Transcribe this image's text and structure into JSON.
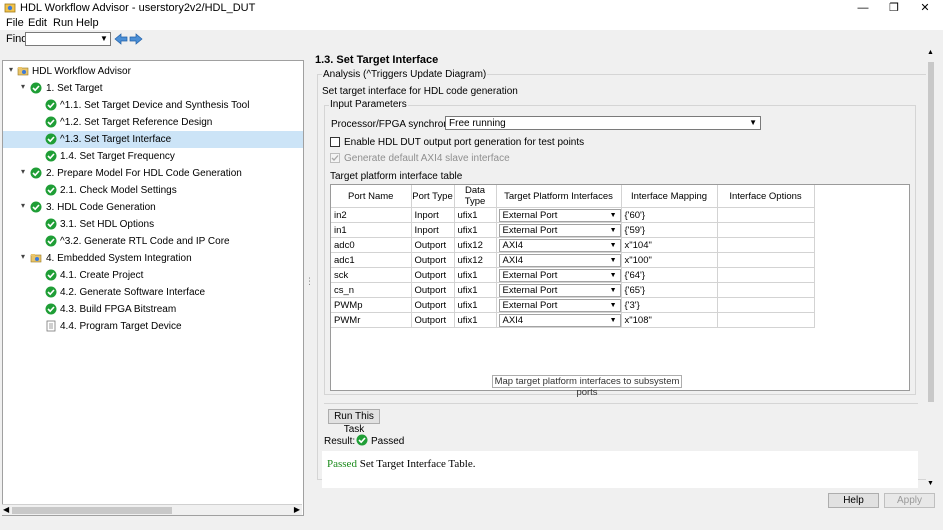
{
  "window": {
    "title": "HDL Workflow Advisor - userstory2v2/HDL_DUT",
    "minimize": "—",
    "maximize": "❐",
    "close": "✕"
  },
  "menu": [
    "File",
    "Edit",
    "Run",
    "Help"
  ],
  "find": {
    "label": "Find:",
    "value": ""
  },
  "tree": [
    {
      "label": "HDL Workflow Advisor",
      "icon": "folder-icon",
      "expander": "▾"
    },
    {
      "label": "1. Set Target",
      "icon": "check-icon",
      "expander": "▾"
    },
    {
      "label": "^1.1. Set Target Device and Synthesis Tool",
      "icon": "check-icon"
    },
    {
      "label": "^1.2. Set Target Reference Design",
      "icon": "check-icon"
    },
    {
      "label": "^1.3. Set Target Interface",
      "icon": "check-icon",
      "selected": true
    },
    {
      "label": "1.4. Set Target Frequency",
      "icon": "check-icon"
    },
    {
      "label": "2. Prepare Model For HDL Code Generation",
      "icon": "check-icon",
      "expander": "▾"
    },
    {
      "label": "2.1. Check Model Settings",
      "icon": "check-icon"
    },
    {
      "label": "3. HDL Code Generation",
      "icon": "check-icon",
      "expander": "▾"
    },
    {
      "label": "3.1. Set HDL Options",
      "icon": "check-icon"
    },
    {
      "label": "^3.2. Generate RTL Code and IP Core",
      "icon": "check-icon"
    },
    {
      "label": "4. Embedded System Integration",
      "icon": "folder-icon",
      "expander": "▾"
    },
    {
      "label": "4.1. Create Project",
      "icon": "check-icon"
    },
    {
      "label": "4.2. Generate Software Interface",
      "icon": "check-icon"
    },
    {
      "label": "4.3. Build FPGA Bitstream",
      "icon": "check-icon"
    },
    {
      "label": "4.4. Program Target Device",
      "icon": "task-icon"
    }
  ],
  "panel": {
    "title": "1.3. Set Target Interface",
    "analysis": "Analysis (^Triggers Update Diagram)",
    "description": "Set target interface for HDL code generation",
    "input_params_label": "Input Parameters",
    "sync_label": "Processor/FPGA synchronization:",
    "sync_value": "Free running",
    "enable_test_points": "Enable HDL DUT output port generation for test points",
    "generate_axi4": "Generate default AXI4 slave interface",
    "table_label": "Target platform interface table",
    "map_button": "Map target platform interfaces to subsystem ports",
    "run_button": "Run This Task",
    "result_label": "Result:",
    "result_value": "Passed",
    "result_msg_status": "Passed",
    "result_msg_text": " Set Target Interface Table."
  },
  "table": {
    "headers": [
      "Port Name",
      "Port Type",
      "Data Type",
      "Target Platform Interfaces",
      "Interface Mapping",
      "Interface Options"
    ],
    "rows": [
      [
        "in2",
        "Inport",
        "ufix1",
        "External Port",
        "{'60'}",
        ""
      ],
      [
        "in1",
        "Inport",
        "ufix1",
        "External Port",
        "{'59'}",
        ""
      ],
      [
        "adc0",
        "Outport",
        "ufix12",
        "AXI4",
        "x\"104\"",
        ""
      ],
      [
        "adc1",
        "Outport",
        "ufix12",
        "AXI4",
        "x\"100\"",
        ""
      ],
      [
        "sck",
        "Outport",
        "ufix1",
        "External Port",
        "{'64'}",
        ""
      ],
      [
        "cs_n",
        "Outport",
        "ufix1",
        "External Port",
        "{'65'}",
        ""
      ],
      [
        "PWMp",
        "Outport",
        "ufix1",
        "External Port",
        "{'3'}",
        ""
      ],
      [
        "PWMr",
        "Outport",
        "ufix1",
        "AXI4",
        "x\"108\"",
        ""
      ]
    ]
  },
  "footer": {
    "help": "Help",
    "apply": "Apply"
  },
  "colors": {
    "check_green": "#1f9e36",
    "selection": "#cce4f7",
    "passed_text": "#1a8a1a"
  }
}
